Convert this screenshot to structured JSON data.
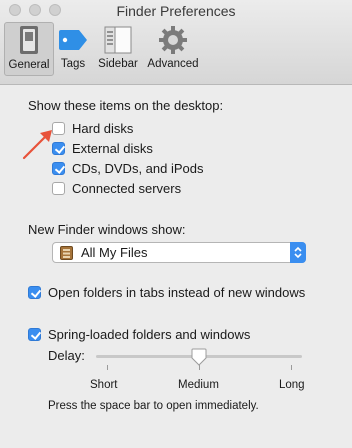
{
  "window": {
    "title": "Finder Preferences"
  },
  "tabs": [
    {
      "label": "General",
      "icon": "general-switch-icon",
      "active": true
    },
    {
      "label": "Tags",
      "icon": "tag-icon",
      "active": false
    },
    {
      "label": "Sidebar",
      "icon": "sidebar-icon",
      "active": false
    },
    {
      "label": "Advanced",
      "icon": "gear-icon",
      "active": false
    }
  ],
  "desktop": {
    "heading": "Show these items on the desktop:",
    "items": [
      {
        "label": "Hard disks",
        "checked": false
      },
      {
        "label": "External disks",
        "checked": true
      },
      {
        "label": "CDs, DVDs, and iPods",
        "checked": true
      },
      {
        "label": "Connected servers",
        "checked": false
      }
    ]
  },
  "new_window": {
    "heading": "New Finder windows show:",
    "selected": "All My Files"
  },
  "open_in_tabs": {
    "label": "Open folders in tabs instead of new windows",
    "checked": true
  },
  "spring_loaded": {
    "label": "Spring-loaded folders and windows",
    "checked": true,
    "delay_label": "Delay:",
    "delay_value_fraction": 0.5,
    "ticks": [
      "Short",
      "Medium",
      "Long"
    ],
    "hint": "Press the space bar to open immediately."
  },
  "colors": {
    "accent": "#3a8ef0",
    "annotation_arrow": "#e8523a"
  }
}
